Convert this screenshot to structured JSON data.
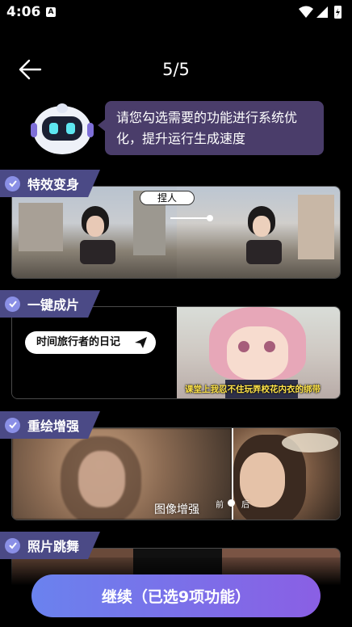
{
  "status_bar": {
    "time": "4:06",
    "notification_badge": "A"
  },
  "nav": {
    "page_indicator": "5/5"
  },
  "assistant": {
    "message": "请您勾选需要的功能进行系统优化，提升运行生成速度"
  },
  "features": [
    {
      "label": "特效变身",
      "checked": true,
      "overlay": "捏人"
    },
    {
      "label": "一键成片",
      "checked": true,
      "overlay": "时间旅行者的日记",
      "caption": "课堂上我忍不住玩弄校花内衣的绑带"
    },
    {
      "label": "重绘增强",
      "checked": true,
      "overlay": "图像增强",
      "before": "前",
      "after": "后"
    },
    {
      "label": "照片跳舞",
      "checked": true
    }
  ],
  "continue_button": {
    "label": "继续（已选9项功能）"
  },
  "colors": {
    "tag_bg": "#4b4a86",
    "check_bg": "#8a8fe6",
    "bubble_bg": "#4a3d6a",
    "button_from": "#6a82ee",
    "button_to": "#8a5fe4"
  }
}
